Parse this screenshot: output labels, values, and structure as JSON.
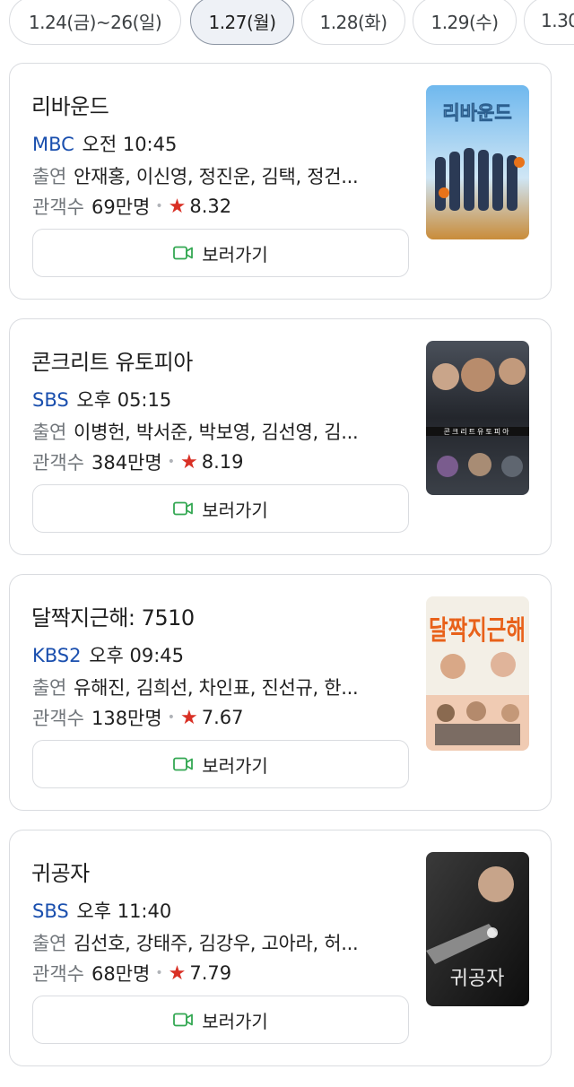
{
  "date_tabs": [
    {
      "label": "1.24(금)~26(일)",
      "active": false
    },
    {
      "label": "1.27(월)",
      "active": true
    },
    {
      "label": "1.28(화)",
      "active": false
    },
    {
      "label": "1.29(수)",
      "active": false
    },
    {
      "label": "1.30",
      "active": false
    }
  ],
  "labels": {
    "cast": "출연",
    "audience": "관객수",
    "watch_button": "보러가기"
  },
  "movies": [
    {
      "title": "리바운드",
      "channel": "MBC",
      "airtime": "오전 10:45",
      "cast": "안재홍, 이신영, 정진운, 김택, 정건...",
      "audience": "69만명",
      "rating": "8.32",
      "poster_text": "리바운드",
      "poster_colors": [
        "#5aa9e6",
        "#e8a33c",
        "#2b5f8f"
      ]
    },
    {
      "title": "콘크리트 유토피아",
      "channel": "SBS",
      "airtime": "오후 05:15",
      "cast": "이병헌, 박서준, 박보영, 김선영, 김...",
      "audience": "384만명",
      "rating": "8.19",
      "poster_text": "콘크리트유토피아",
      "poster_colors": [
        "#3a3f47",
        "#1c1f24",
        "#6b7280"
      ]
    },
    {
      "title": "달짝지근해: 7510",
      "channel": "KBS2",
      "airtime": "오후 09:45",
      "cast": "유해진, 김희선, 차인표, 진선규, 한...",
      "audience": "138만명",
      "rating": "7.67",
      "poster_text": "달짝지근해",
      "poster_colors": [
        "#f3efe6",
        "#e8611a",
        "#2d2d2d"
      ]
    },
    {
      "title": "귀공자",
      "channel": "SBS",
      "airtime": "오후 11:40",
      "cast": "김선호, 강태주, 김강우, 고아라, 허...",
      "audience": "68만명",
      "rating": "7.79",
      "poster_text": "귀공자",
      "poster_colors": [
        "#2a2a2a",
        "#0f0f0f",
        "#8a8a8a"
      ]
    }
  ],
  "colors": {
    "channel": "#1a4fae",
    "star": "#d93025",
    "watch_icon": "#34a853"
  },
  "icons": {
    "watch": "video-camera-icon",
    "star": "star-icon"
  }
}
